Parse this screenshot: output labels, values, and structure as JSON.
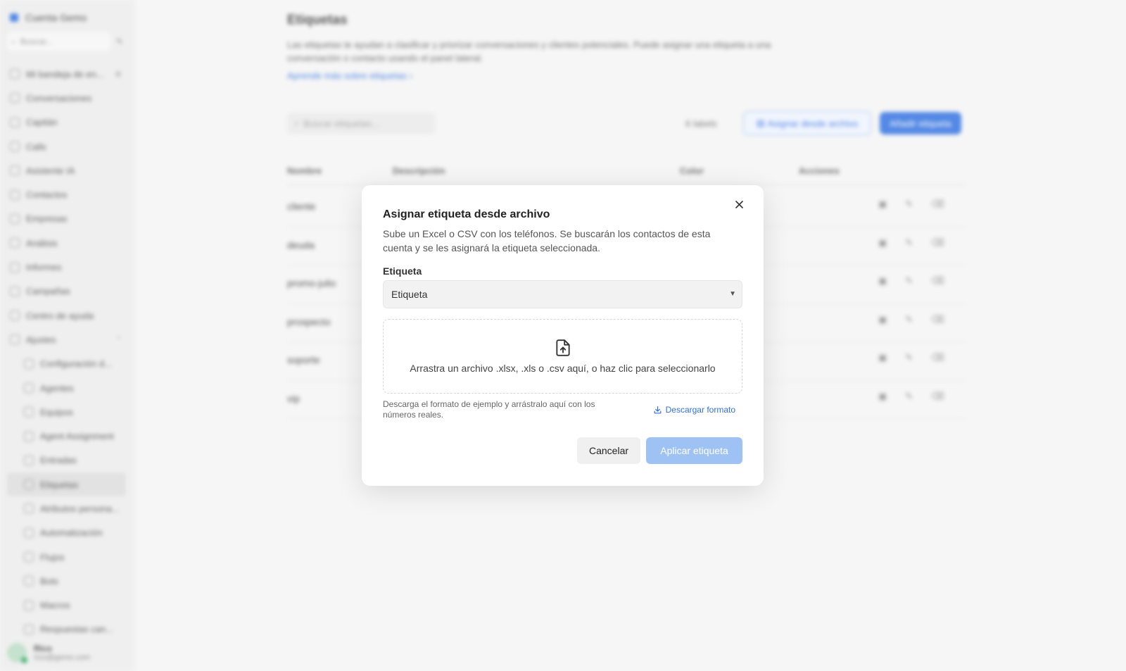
{
  "sidebar": {
    "brand": "Cuenta Gemo",
    "search_placeholder": "Buscar...",
    "items": [
      {
        "label": "Mi bandeja de en..."
      },
      {
        "label": "Conversaciones"
      },
      {
        "label": "Capitán"
      },
      {
        "label": "Calls"
      },
      {
        "label": "Asistente IA"
      },
      {
        "label": "Contactos"
      },
      {
        "label": "Empresas"
      },
      {
        "label": "Análisis"
      },
      {
        "label": "Informes"
      },
      {
        "label": "Campañas"
      },
      {
        "label": "Centro de ayuda"
      },
      {
        "label": "Ajustes"
      }
    ],
    "sub_items": [
      {
        "label": "Configuración d..."
      },
      {
        "label": "Agentes"
      },
      {
        "label": "Equipos"
      },
      {
        "label": "Agent Assignment"
      },
      {
        "label": "Entradas"
      },
      {
        "label": "Etiquetas"
      },
      {
        "label": "Atributos persona..."
      },
      {
        "label": "Automatización"
      },
      {
        "label": "Flujos"
      },
      {
        "label": "Bots"
      },
      {
        "label": "Macros"
      },
      {
        "label": "Respuestas can..."
      }
    ],
    "user": {
      "name": "Rico",
      "email": "rico@gemo.com"
    }
  },
  "page": {
    "title": "Etiquetas",
    "description": "Las etiquetas te ayudan a clasificar y priorizar conversaciones y clientes potenciales. Puede asignar una etiqueta a una conversación o contacto usando el panel lateral.",
    "learn_more": "Aprende más sobre etiquetas",
    "search_placeholder": "Buscar etiquetas...",
    "count": "6 labels",
    "assign_button": "Asignar desde archivo",
    "add_button": "Añadir etiqueta",
    "columns": [
      "Nombre",
      "Descripción",
      "Color",
      "Acciones"
    ],
    "rows": [
      {
        "name": "cliente"
      },
      {
        "name": "deuda"
      },
      {
        "name": "promo-julio"
      },
      {
        "name": "prospecto"
      },
      {
        "name": "soporte"
      },
      {
        "name": "vip"
      }
    ]
  },
  "modal": {
    "title": "Asignar etiqueta desde archivo",
    "description": "Sube un Excel o CSV con los teléfonos. Se buscarán los contactos de esta cuenta y se les asignará la etiqueta seleccionada.",
    "label_field": "Etiqueta",
    "select_value": "Etiqueta",
    "dropzone_text": "Arrastra un archivo .xlsx, .xls o .csv aquí, o haz clic para seleccionarlo",
    "hint": "Descarga el formato de ejemplo y arrástralo aquí con los números reales.",
    "download_link": "Descargar formato",
    "cancel": "Cancelar",
    "apply": "Aplicar etiqueta"
  },
  "colors": {
    "accent": "#2f6fe0",
    "apply_disabled": "#9fc2f5"
  }
}
